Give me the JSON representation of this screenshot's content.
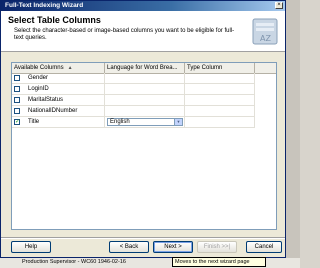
{
  "window": {
    "title": "Full-Text Indexing Wizard",
    "close_glyph": "×"
  },
  "header": {
    "heading": "Select Table Columns",
    "subtext": "Select the character-based or image-based columns you want to be eligible for full-text queries."
  },
  "grid": {
    "columns": [
      "Available Columns",
      "Language for Word Brea...",
      "Type Column"
    ],
    "sort_glyph": "▲",
    "rows": [
      {
        "name": "Gender",
        "checked": false,
        "language": ""
      },
      {
        "name": "LoginID",
        "checked": false,
        "language": ""
      },
      {
        "name": "MaritalStatus",
        "checked": false,
        "language": ""
      },
      {
        "name": "NationalIDNumber",
        "checked": false,
        "language": ""
      },
      {
        "name": "Title",
        "checked": true,
        "check_glyph": "✓",
        "language": "English"
      }
    ],
    "dropdown_glyph": "▼"
  },
  "buttons": {
    "help": "Help",
    "back": "< Back",
    "next": "Next >",
    "finish": "Finish >>|",
    "cancel": "Cancel"
  },
  "tooltip": "Moves to the next wizard page",
  "background_text": "Production Supervisor - WC60    1946-02-16",
  "colors": {
    "titlebar": "#0a246a",
    "accent": "#7f9db9",
    "tooltip_bg": "#ffffe1"
  }
}
